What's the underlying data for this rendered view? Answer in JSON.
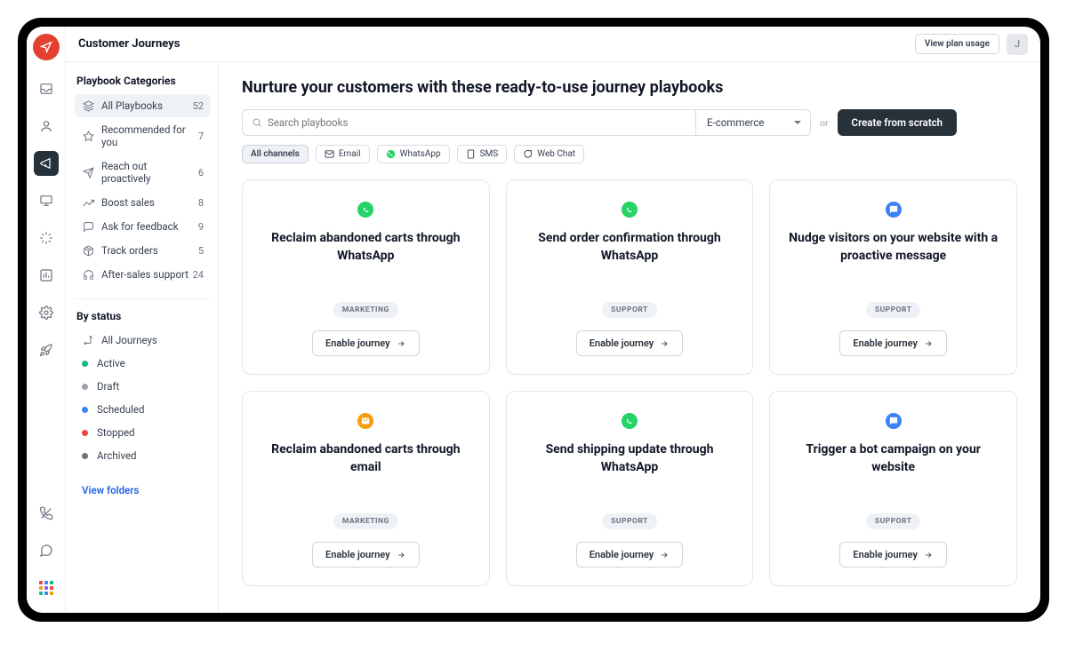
{
  "header": {
    "title": "Customer Journeys",
    "plan_btn": "View plan usage",
    "avatar_letter": "J"
  },
  "sidebar": {
    "categories_heading": "Playbook Categories",
    "status_heading": "By status",
    "view_folders": "View folders",
    "categories": [
      {
        "label": "All Playbooks",
        "count": "52",
        "icon": "layers"
      },
      {
        "label": "Recommended for you",
        "count": "7",
        "icon": "star"
      },
      {
        "label": "Reach out proactively",
        "count": "6",
        "icon": "send"
      },
      {
        "label": "Boost sales",
        "count": "8",
        "icon": "trending"
      },
      {
        "label": "Ask for feedback",
        "count": "9",
        "icon": "comment"
      },
      {
        "label": "Track orders",
        "count": "5",
        "icon": "package"
      },
      {
        "label": "After-sales support",
        "count": "24",
        "icon": "headset"
      }
    ],
    "statuses": [
      {
        "label": "All Journeys",
        "color": "",
        "icon": "route"
      },
      {
        "label": "Active",
        "color": "#10b981"
      },
      {
        "label": "Draft",
        "color": "#9ca3af"
      },
      {
        "label": "Scheduled",
        "color": "#3b82f6"
      },
      {
        "label": "Stopped",
        "color": "#ef4444"
      },
      {
        "label": "Archived",
        "color": "#6b7280"
      }
    ]
  },
  "main": {
    "headline": "Nurture your customers with these ready-to-use journey playbooks",
    "search_placeholder": "Search playbooks",
    "category_selected": "E-commerce",
    "or": "or",
    "create_btn": "Create from scratch",
    "chips": [
      {
        "label": "All channels"
      },
      {
        "label": "Email"
      },
      {
        "label": "WhatsApp"
      },
      {
        "label": "SMS"
      },
      {
        "label": "Web Chat"
      }
    ],
    "enable_btn": "Enable journey",
    "cards": [
      {
        "icon": "whatsapp",
        "title": "Reclaim abandoned carts through WhatsApp",
        "tag": "MARKETING"
      },
      {
        "icon": "whatsapp",
        "title": "Send order confirmation through WhatsApp",
        "tag": "SUPPORT"
      },
      {
        "icon": "chat",
        "title": "Nudge visitors on your website with a proactive message",
        "tag": "SUPPORT"
      },
      {
        "icon": "email",
        "title": "Reclaim abandoned carts through email",
        "tag": "MARKETING"
      },
      {
        "icon": "whatsapp",
        "title": "Send shipping update through WhatsApp",
        "tag": "SUPPORT"
      },
      {
        "icon": "chat",
        "title": "Trigger a bot campaign on your website",
        "tag": "SUPPORT"
      }
    ]
  }
}
